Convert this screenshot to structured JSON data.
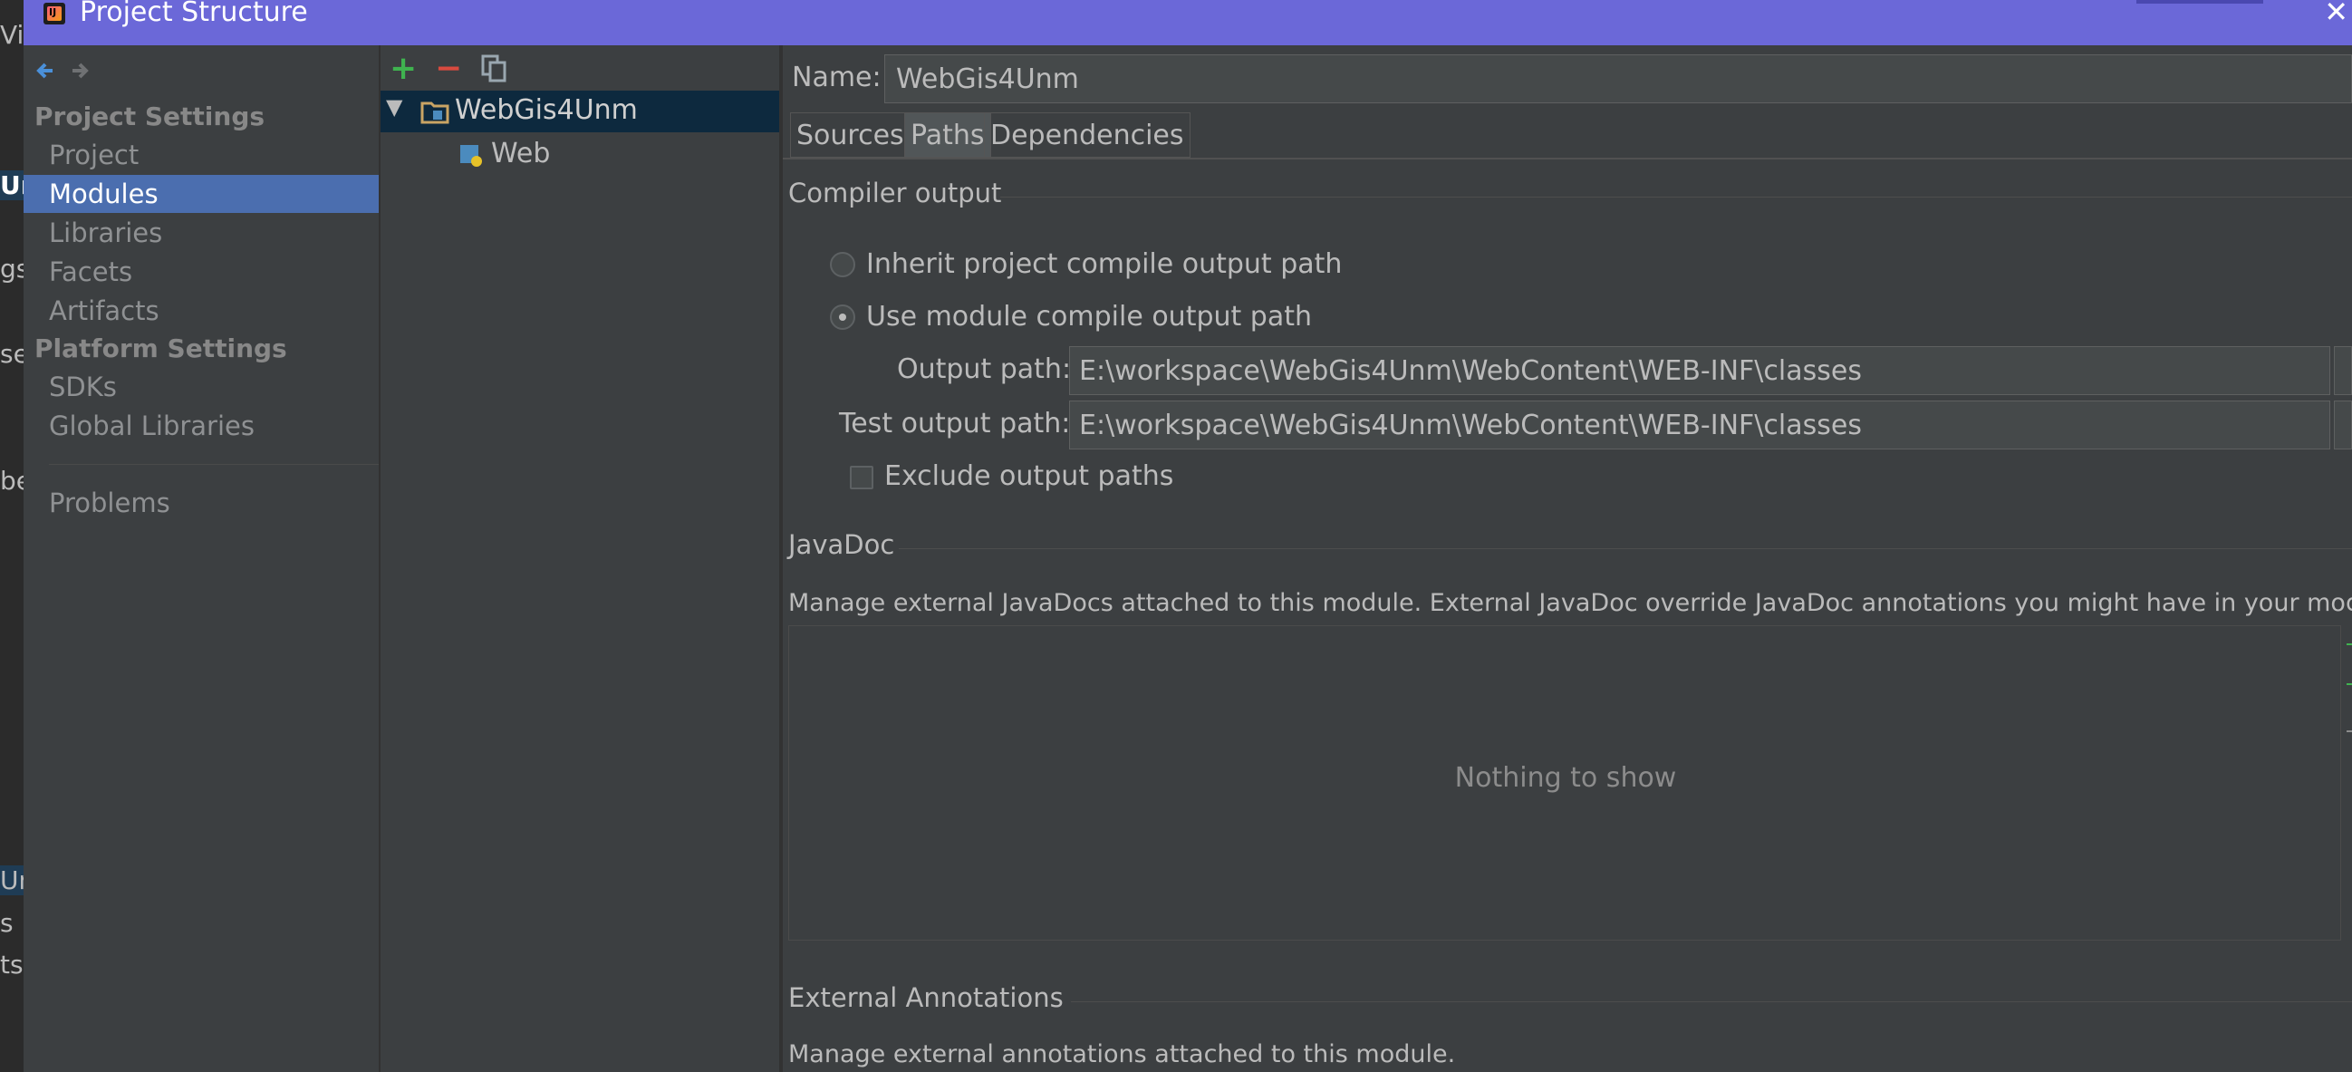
{
  "window": {
    "title": "Project Structure"
  },
  "background_fragments": [
    "Vig",
    "Ur",
    "gs",
    "se",
    "be",
    "Un",
    "s",
    "ts"
  ],
  "nav": {
    "project_settings_header": "Project Settings",
    "project_items": [
      "Project",
      "Modules",
      "Libraries",
      "Facets",
      "Artifacts"
    ],
    "platform_settings_header": "Platform Settings",
    "platform_items": [
      "SDKs",
      "Global Libraries"
    ],
    "problems": "Problems",
    "selected": "Modules"
  },
  "tree": {
    "root": "WebGis4Unm",
    "child": "Web"
  },
  "module": {
    "name_label": "Name:",
    "name_value": "WebGis4Unm",
    "tabs": [
      "Sources",
      "Paths",
      "Dependencies"
    ],
    "active_tab": "Paths"
  },
  "compiler_output": {
    "title": "Compiler output",
    "inherit_label": "Inherit project compile output path",
    "use_module_label": "Use module compile output path",
    "selected_option": "use_module",
    "output_path_label": "Output path:",
    "output_path_value": "E:\\workspace\\WebGis4Unm\\WebContent\\WEB-INF\\classes",
    "test_output_path_label": "Test output path:",
    "test_output_path_value": "E:\\workspace\\WebGis4Unm\\WebContent\\WEB-INF\\classes",
    "exclude_label": "Exclude output paths",
    "exclude_checked": false
  },
  "javadoc": {
    "title": "JavaDoc",
    "description": "Manage external JavaDocs attached to this module. External JavaDoc override JavaDoc annotations you might have in your module.",
    "empty_text": "Nothing to show"
  },
  "external_annotations": {
    "title": "External Annotations",
    "description": "Manage external annotations attached to this module."
  },
  "colors": {
    "title_bar": "#6b68d8",
    "selection": "#4b6eaf",
    "panel": "#3c3f41",
    "add_green": "#3fb34f",
    "remove_red": "#d94a3f"
  }
}
